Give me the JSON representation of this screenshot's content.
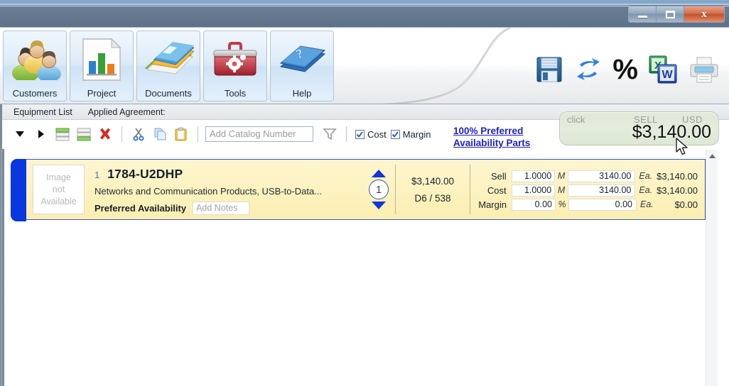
{
  "window": {
    "controls": {
      "minimize": "minimize-button",
      "maximize": "maximize-button",
      "close": "close-button",
      "close_glyph": "x"
    }
  },
  "ribbon": {
    "buttons": [
      {
        "label": "Customers",
        "icon": "customers-people-icon"
      },
      {
        "label": "Project",
        "icon": "project-barchart-document-icon"
      },
      {
        "label": "Documents",
        "icon": "documents-books-icon"
      },
      {
        "label": "Tools",
        "icon": "tools-toolbox-icon"
      },
      {
        "label": "Help",
        "icon": "help-book-icon"
      }
    ],
    "actions": [
      {
        "name": "save-icon",
        "title": "Save"
      },
      {
        "name": "refresh-sync-icon",
        "title": "Refresh"
      },
      {
        "name": "percent-icon",
        "title": "Percent"
      },
      {
        "name": "export-office-icon",
        "title": "Export to Excel/Word"
      },
      {
        "name": "print-icon",
        "title": "Print"
      }
    ]
  },
  "subbar": {
    "tab_equipment_list": "Equipment List",
    "tab_applied_agreement": "Applied Agreement:",
    "tools": [
      {
        "name": "collapse-all-icon"
      },
      {
        "name": "expand-all-icon"
      },
      {
        "name": "insert-row-above-icon"
      },
      {
        "name": "insert-row-below-icon"
      },
      {
        "name": "delete-row-icon"
      },
      {
        "name": "cut-icon"
      },
      {
        "name": "copy-icon"
      },
      {
        "name": "paste-icon"
      }
    ],
    "catalog_placeholder": "Add Catalog Number",
    "catalog_value": "",
    "filter_icon": "filter-funnel-icon",
    "checkboxes": [
      {
        "label": "Cost",
        "checked": true
      },
      {
        "label": "Margin",
        "checked": true
      }
    ]
  },
  "preferred_link": "100% Preferred Availability Parts",
  "sell_panel": {
    "click_label": "click",
    "sell_label": "SELL",
    "currency_label": "USD",
    "amount": "$3,140.00",
    "accent": "#dfe9d8"
  },
  "item": {
    "image_placeholder_lines": [
      "Image",
      "not",
      "Available"
    ],
    "line_number": "1",
    "catalog_number": "1784-U2DHP",
    "description": "Networks and Communication Products, USB-to-Data...",
    "availability_label": "Preferred Availability",
    "notes_placeholder": "Add Notes",
    "quantity": "1",
    "extended_total": "$3,140.00",
    "location_code": "D6 / 538",
    "grid": [
      {
        "label": "Sell",
        "factor": "1.0000",
        "unit": "M",
        "price": "3140.00",
        "per": "Ea.",
        "total": "$3,140.00"
      },
      {
        "label": "Cost",
        "factor": "1.0000",
        "unit": "M",
        "price": "3140.00",
        "per": "Ea.",
        "total": "$3,140.00"
      },
      {
        "label": "Margin",
        "factor": "0.00",
        "unit": "%",
        "price": "0.00",
        "per": "Ea.",
        "total": "$0.00"
      }
    ]
  }
}
